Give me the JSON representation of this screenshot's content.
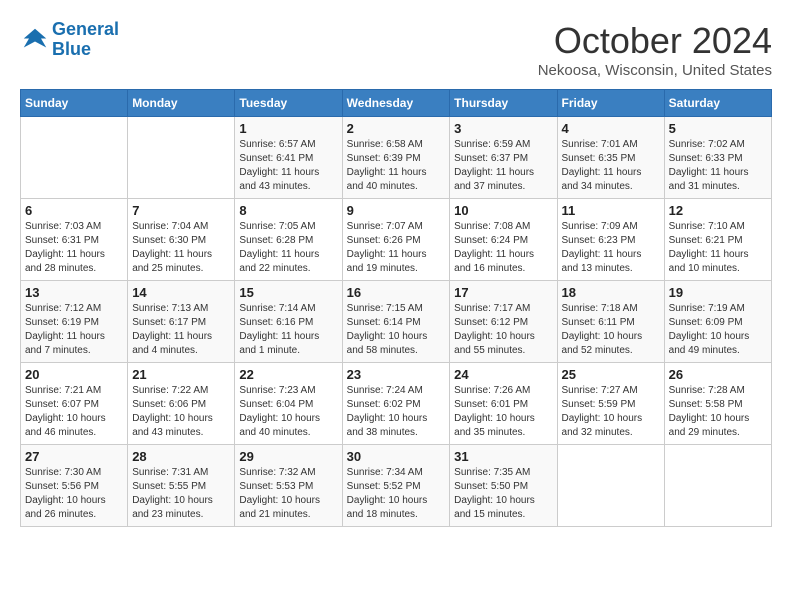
{
  "header": {
    "logo_line1": "General",
    "logo_line2": "Blue",
    "month": "October 2024",
    "location": "Nekoosa, Wisconsin, United States"
  },
  "days_of_week": [
    "Sunday",
    "Monday",
    "Tuesday",
    "Wednesday",
    "Thursday",
    "Friday",
    "Saturday"
  ],
  "weeks": [
    [
      {
        "day": "",
        "info": ""
      },
      {
        "day": "",
        "info": ""
      },
      {
        "day": "1",
        "info": "Sunrise: 6:57 AM\nSunset: 6:41 PM\nDaylight: 11 hours and 43 minutes."
      },
      {
        "day": "2",
        "info": "Sunrise: 6:58 AM\nSunset: 6:39 PM\nDaylight: 11 hours and 40 minutes."
      },
      {
        "day": "3",
        "info": "Sunrise: 6:59 AM\nSunset: 6:37 PM\nDaylight: 11 hours and 37 minutes."
      },
      {
        "day": "4",
        "info": "Sunrise: 7:01 AM\nSunset: 6:35 PM\nDaylight: 11 hours and 34 minutes."
      },
      {
        "day": "5",
        "info": "Sunrise: 7:02 AM\nSunset: 6:33 PM\nDaylight: 11 hours and 31 minutes."
      }
    ],
    [
      {
        "day": "6",
        "info": "Sunrise: 7:03 AM\nSunset: 6:31 PM\nDaylight: 11 hours and 28 minutes."
      },
      {
        "day": "7",
        "info": "Sunrise: 7:04 AM\nSunset: 6:30 PM\nDaylight: 11 hours and 25 minutes."
      },
      {
        "day": "8",
        "info": "Sunrise: 7:05 AM\nSunset: 6:28 PM\nDaylight: 11 hours and 22 minutes."
      },
      {
        "day": "9",
        "info": "Sunrise: 7:07 AM\nSunset: 6:26 PM\nDaylight: 11 hours and 19 minutes."
      },
      {
        "day": "10",
        "info": "Sunrise: 7:08 AM\nSunset: 6:24 PM\nDaylight: 11 hours and 16 minutes."
      },
      {
        "day": "11",
        "info": "Sunrise: 7:09 AM\nSunset: 6:23 PM\nDaylight: 11 hours and 13 minutes."
      },
      {
        "day": "12",
        "info": "Sunrise: 7:10 AM\nSunset: 6:21 PM\nDaylight: 11 hours and 10 minutes."
      }
    ],
    [
      {
        "day": "13",
        "info": "Sunrise: 7:12 AM\nSunset: 6:19 PM\nDaylight: 11 hours and 7 minutes."
      },
      {
        "day": "14",
        "info": "Sunrise: 7:13 AM\nSunset: 6:17 PM\nDaylight: 11 hours and 4 minutes."
      },
      {
        "day": "15",
        "info": "Sunrise: 7:14 AM\nSunset: 6:16 PM\nDaylight: 11 hours and 1 minute."
      },
      {
        "day": "16",
        "info": "Sunrise: 7:15 AM\nSunset: 6:14 PM\nDaylight: 10 hours and 58 minutes."
      },
      {
        "day": "17",
        "info": "Sunrise: 7:17 AM\nSunset: 6:12 PM\nDaylight: 10 hours and 55 minutes."
      },
      {
        "day": "18",
        "info": "Sunrise: 7:18 AM\nSunset: 6:11 PM\nDaylight: 10 hours and 52 minutes."
      },
      {
        "day": "19",
        "info": "Sunrise: 7:19 AM\nSunset: 6:09 PM\nDaylight: 10 hours and 49 minutes."
      }
    ],
    [
      {
        "day": "20",
        "info": "Sunrise: 7:21 AM\nSunset: 6:07 PM\nDaylight: 10 hours and 46 minutes."
      },
      {
        "day": "21",
        "info": "Sunrise: 7:22 AM\nSunset: 6:06 PM\nDaylight: 10 hours and 43 minutes."
      },
      {
        "day": "22",
        "info": "Sunrise: 7:23 AM\nSunset: 6:04 PM\nDaylight: 10 hours and 40 minutes."
      },
      {
        "day": "23",
        "info": "Sunrise: 7:24 AM\nSunset: 6:02 PM\nDaylight: 10 hours and 38 minutes."
      },
      {
        "day": "24",
        "info": "Sunrise: 7:26 AM\nSunset: 6:01 PM\nDaylight: 10 hours and 35 minutes."
      },
      {
        "day": "25",
        "info": "Sunrise: 7:27 AM\nSunset: 5:59 PM\nDaylight: 10 hours and 32 minutes."
      },
      {
        "day": "26",
        "info": "Sunrise: 7:28 AM\nSunset: 5:58 PM\nDaylight: 10 hours and 29 minutes."
      }
    ],
    [
      {
        "day": "27",
        "info": "Sunrise: 7:30 AM\nSunset: 5:56 PM\nDaylight: 10 hours and 26 minutes."
      },
      {
        "day": "28",
        "info": "Sunrise: 7:31 AM\nSunset: 5:55 PM\nDaylight: 10 hours and 23 minutes."
      },
      {
        "day": "29",
        "info": "Sunrise: 7:32 AM\nSunset: 5:53 PM\nDaylight: 10 hours and 21 minutes."
      },
      {
        "day": "30",
        "info": "Sunrise: 7:34 AM\nSunset: 5:52 PM\nDaylight: 10 hours and 18 minutes."
      },
      {
        "day": "31",
        "info": "Sunrise: 7:35 AM\nSunset: 5:50 PM\nDaylight: 10 hours and 15 minutes."
      },
      {
        "day": "",
        "info": ""
      },
      {
        "day": "",
        "info": ""
      }
    ]
  ]
}
